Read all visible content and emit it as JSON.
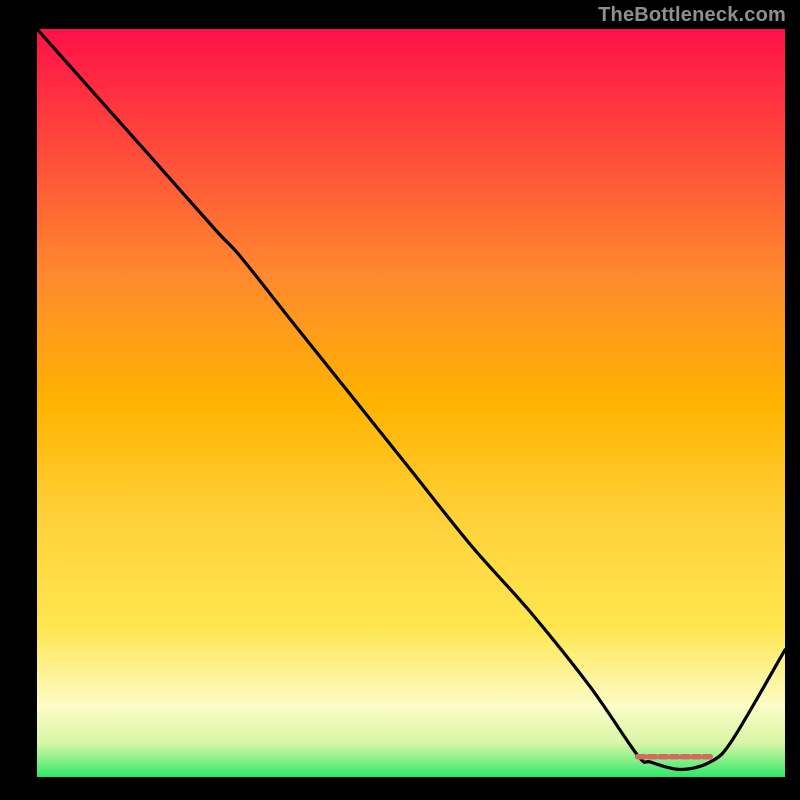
{
  "watermark": "TheBottleneck.com",
  "colors": {
    "top": "#ff1049",
    "mid": "#ffb300",
    "lower": "#ffe64f",
    "pale": "#fdfcc7",
    "green": "#2ce86a",
    "line": "#000000",
    "marker": "#d46a5f"
  },
  "chart_data": {
    "type": "line",
    "title": "",
    "xlabel": "",
    "ylabel": "",
    "xlim": [
      0,
      100
    ],
    "ylim": [
      0,
      100
    ],
    "grid": false,
    "legend": false,
    "series": [
      {
        "name": "curve",
        "x": [
          0,
          8,
          16,
          24,
          27.1,
          34,
          42,
          50,
          58,
          66,
          74,
          80.3,
          82,
          86,
          90,
          93,
          100
        ],
        "y": [
          100,
          91,
          82,
          73,
          69.7,
          61,
          51,
          41,
          31,
          22,
          12,
          2.9,
          2,
          1,
          2,
          5,
          17
        ]
      }
    ],
    "annotations": [
      {
        "type": "optimum-marker",
        "x_start": 80.3,
        "x_end": 90.0,
        "y": 2.7
      }
    ],
    "notes": "x and y are in plot-percent space (0..100 each); values read from geometry, approximate."
  }
}
